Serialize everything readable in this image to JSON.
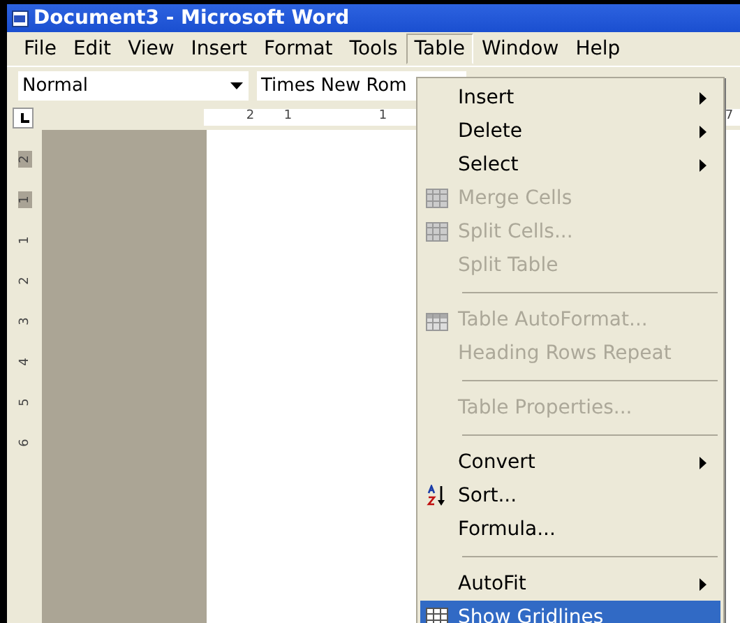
{
  "window": {
    "title": "Document3 - Microsoft Word"
  },
  "menubar": [
    {
      "label": "File",
      "selected": false
    },
    {
      "label": "Edit",
      "selected": false
    },
    {
      "label": "View",
      "selected": false
    },
    {
      "label": "Insert",
      "selected": false
    },
    {
      "label": "Format",
      "selected": false
    },
    {
      "label": "Tools",
      "selected": false
    },
    {
      "label": "Table",
      "selected": true
    },
    {
      "label": "Window",
      "selected": false
    },
    {
      "label": "Help",
      "selected": false
    }
  ],
  "toolbar": {
    "style": "Normal",
    "font": "Times New Rom"
  },
  "ruler": {
    "labels": [
      "2",
      "1",
      "1",
      "7"
    ]
  },
  "vertical_ruler": [
    {
      "label": "2",
      "shaded": true
    },
    {
      "label": "1",
      "shaded": true
    },
    {
      "label": "1",
      "shaded": false
    },
    {
      "label": "2",
      "shaded": false
    },
    {
      "label": "3",
      "shaded": false
    },
    {
      "label": "4",
      "shaded": false
    },
    {
      "label": "5",
      "shaded": false
    },
    {
      "label": "6",
      "shaded": false
    }
  ],
  "menu": [
    {
      "kind": "item",
      "label": "Insert",
      "disabled": false,
      "submenu": true,
      "selected": false
    },
    {
      "kind": "item",
      "label": "Delete",
      "disabled": false,
      "submenu": true,
      "selected": false
    },
    {
      "kind": "item",
      "label": "Select",
      "disabled": false,
      "submenu": true,
      "selected": false
    },
    {
      "kind": "item",
      "label": "Merge Cells",
      "disabled": true,
      "submenu": false,
      "selected": false
    },
    {
      "kind": "item",
      "label": "Split Cells...",
      "disabled": true,
      "submenu": false,
      "selected": false
    },
    {
      "kind": "item",
      "label": "Split Table",
      "disabled": true,
      "submenu": false,
      "selected": false
    },
    {
      "kind": "separator"
    },
    {
      "kind": "item",
      "label": "Table AutoFormat...",
      "disabled": true,
      "submenu": false,
      "selected": false
    },
    {
      "kind": "item",
      "label": "Heading Rows Repeat",
      "disabled": true,
      "submenu": false,
      "selected": false
    },
    {
      "kind": "separator"
    },
    {
      "kind": "item",
      "label": "Table Properties...",
      "disabled": true,
      "submenu": false,
      "selected": false
    },
    {
      "kind": "separator"
    },
    {
      "kind": "item",
      "label": "Convert",
      "disabled": false,
      "submenu": true,
      "selected": false
    },
    {
      "kind": "item",
      "label": "Sort...",
      "disabled": false,
      "submenu": false,
      "selected": false
    },
    {
      "kind": "item",
      "label": "Formula...",
      "disabled": false,
      "submenu": false,
      "selected": false
    },
    {
      "kind": "separator"
    },
    {
      "kind": "item",
      "label": "AutoFit",
      "disabled": false,
      "submenu": true,
      "selected": false
    },
    {
      "kind": "item",
      "label": "Show Gridlines",
      "disabled": false,
      "submenu": false,
      "selected": true
    }
  ]
}
